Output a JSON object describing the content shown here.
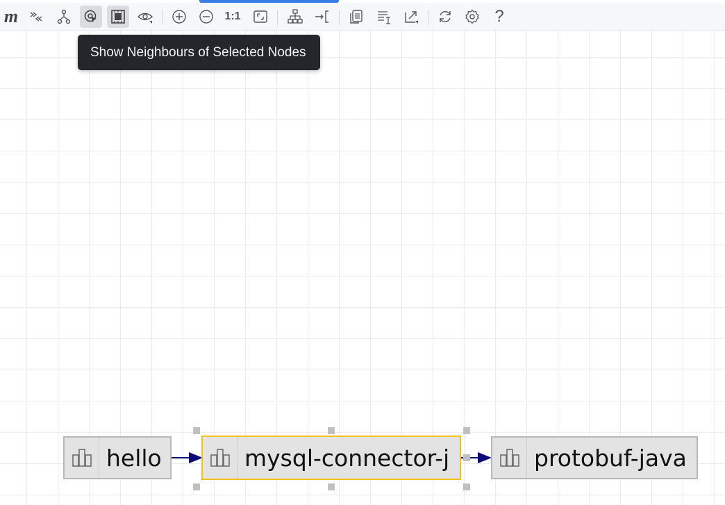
{
  "toolbar": {
    "logo": "m",
    "buttons": [
      {
        "name": "expand-collapse-button",
        "icon": "double-chevron-icon"
      },
      {
        "name": "hierarchy-button",
        "icon": "hierarchy-icon"
      },
      {
        "name": "show-neighbours-button",
        "icon": "target-cursor-icon",
        "active": true
      },
      {
        "name": "select-frame-button",
        "icon": "frame-select-icon",
        "active": true
      },
      {
        "name": "visibility-button",
        "icon": "eye-icon"
      },
      {
        "name": "zoom-in-button",
        "icon": "zoom-in-icon"
      },
      {
        "name": "zoom-out-button",
        "icon": "zoom-out-icon"
      },
      {
        "name": "actual-size-button",
        "icon": "one-to-one-icon"
      },
      {
        "name": "fit-content-button",
        "icon": "fit-icon"
      },
      {
        "name": "layout-button",
        "icon": "tree-layout-icon"
      },
      {
        "name": "navigate-button",
        "icon": "arrow-bracket-icon"
      },
      {
        "name": "copy-button",
        "icon": "copy-icon"
      },
      {
        "name": "text-options-button",
        "icon": "text-cursor-icon"
      },
      {
        "name": "export-button",
        "icon": "export-icon"
      },
      {
        "name": "refresh-button",
        "icon": "refresh-icon"
      },
      {
        "name": "settings-button",
        "icon": "gear-icon"
      },
      {
        "name": "help-button",
        "icon": "question-icon"
      }
    ],
    "actual_size_label": "1:1",
    "help_label": "?"
  },
  "tooltip": {
    "text": "Show Neighbours of Selected Nodes"
  },
  "graph": {
    "nodes": [
      {
        "id": "hello",
        "label": "hello",
        "selected": false
      },
      {
        "id": "mysql",
        "label": "mysql-connector-j",
        "selected": true
      },
      {
        "id": "protobuf",
        "label": "protobuf-java",
        "selected": false
      }
    ],
    "edges": [
      {
        "from": "hello",
        "to": "mysql"
      },
      {
        "from": "mysql",
        "to": "protobuf"
      }
    ],
    "colors": {
      "edge": "#0a0a78",
      "selected_border": "#f2c21b",
      "node_fill": "#e3e3e3"
    }
  }
}
